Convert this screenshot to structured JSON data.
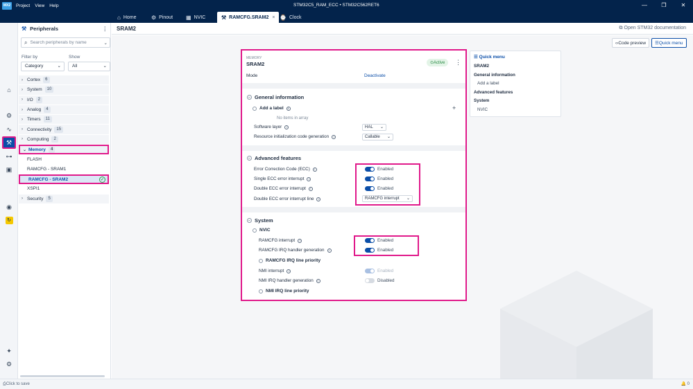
{
  "app": {
    "logo": "MX2",
    "menu": [
      "Project",
      "View",
      "Help"
    ],
    "title": "STM32C5_RAM_ECC  •  STM32C562RET6",
    "window_controls": [
      "—",
      "❐",
      "✕"
    ]
  },
  "tabs": [
    {
      "label": "Home",
      "icon": "home-icon"
    },
    {
      "label": "Pinout",
      "icon": "chip-icon"
    },
    {
      "label": "NVIC",
      "icon": "grid-icon"
    },
    {
      "label": "RAMCFG.SRAM2",
      "icon": "config-icon",
      "active": true
    },
    {
      "label": "Clock",
      "icon": "clock-icon"
    }
  ],
  "peripherals": {
    "title": "Peripherals",
    "search_placeholder": "Search peripherals by name",
    "filter_by_label": "Filter by",
    "filter_by_value": "Category",
    "show_label": "Show",
    "show_value": "All",
    "tree": [
      {
        "label": "Cortex",
        "count": "6"
      },
      {
        "label": "System",
        "count": "10"
      },
      {
        "label": "I/O",
        "count": "2"
      },
      {
        "label": "Analog",
        "count": "4"
      },
      {
        "label": "Timers",
        "count": "11"
      },
      {
        "label": "Connectivity",
        "count": "15"
      },
      {
        "label": "Computing",
        "count": "2"
      },
      {
        "label": "Memory",
        "count": "4",
        "expanded": true
      },
      {
        "label": "FLASH",
        "child": true
      },
      {
        "label": "RAMCFG - SRAM1",
        "child": true
      },
      {
        "label": "RAMCFG - SRAM2",
        "child": true,
        "selected": true
      },
      {
        "label": "XSPI1",
        "child": true
      },
      {
        "label": "Security",
        "count": "5"
      }
    ]
  },
  "main": {
    "title": "SRAM2",
    "open_doc": "Open STM32 documentation",
    "code_preview": "Code preview",
    "quick_menu_button": "Quick menu"
  },
  "card": {
    "kind": "MEMORY",
    "title": "SRAM2",
    "status": "Active",
    "mode_label": "Mode",
    "mode_action": "Deactivate",
    "general": {
      "title": "General information",
      "add_label": "Add a label",
      "no_items": "No items in array",
      "software_layer_label": "Software layer",
      "software_layer_value": "HAL",
      "resource_init_label": "Resource initialization code generation",
      "resource_init_value": "Callable"
    },
    "advanced": {
      "title": "Advanced features",
      "ecc_label": "Error Correction Code (ECC)",
      "ecc_value": "Enabled",
      "single_ecc_label": "Single ECC error interrupt",
      "single_ecc_value": "Enabled",
      "double_ecc_label": "Double ECC error interrupt",
      "double_ecc_value": "Enabled",
      "double_ecc_line_label": "Double ECC error interrupt line",
      "double_ecc_line_value": "RAMCFG interrupt"
    },
    "system": {
      "title": "System",
      "nvic_title": "NVIC",
      "ramcfg_int_label": "RAMCFG interrupt",
      "ramcfg_int_value": "Enabled",
      "ramcfg_irq_gen_label": "RAMCFG IRQ handler generation",
      "ramcfg_irq_gen_value": "Enabled",
      "ramcfg_priority_title": "RAMCFG IRQ line priority",
      "nmi_int_label": "NMI interrupt",
      "nmi_int_value": "Enabled",
      "nmi_irq_gen_label": "NMI IRQ handler generation",
      "nmi_irq_gen_value": "Disabled",
      "nmi_priority_title": "NMI IRQ line priority"
    }
  },
  "quick_menu": {
    "title": "Quick menu",
    "items": [
      {
        "label": "SRAM2",
        "style": "b"
      },
      {
        "label": "General information",
        "style": "b"
      },
      {
        "label": "Add a label",
        "style": "i"
      },
      {
        "label": "Advanced features",
        "style": "b"
      },
      {
        "label": "System",
        "style": "b"
      },
      {
        "label": "NVIC",
        "style": "i"
      }
    ]
  },
  "statusbar": {
    "save": "Click to save",
    "notifications": "0"
  },
  "colors": {
    "navy": "#03234b",
    "accent": "#0b4ea8",
    "highlight": "#e0188a",
    "active_green": "#2a8a44"
  }
}
